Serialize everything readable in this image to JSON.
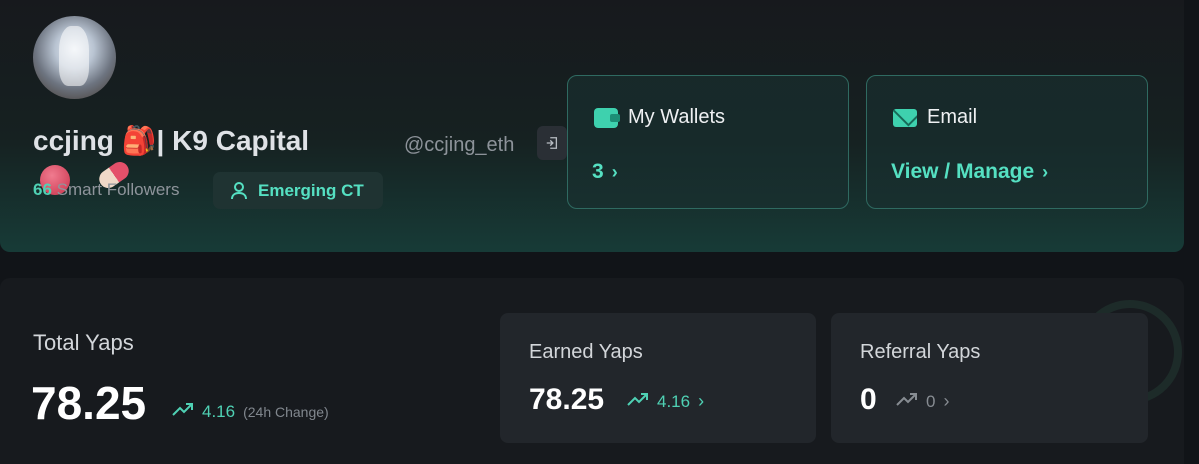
{
  "profile": {
    "display_name": "ccjing 🎒| K9 Capital",
    "display_name_line2": "( 🔴 . 💊 )",
    "handle": "@ccjing_eth",
    "smart_followers_count": "66",
    "smart_followers_label": "Smart Followers",
    "badge": "Emerging CT"
  },
  "wallets": {
    "title": "My Wallets",
    "value": "3"
  },
  "email": {
    "title": "Email",
    "value": "View / Manage"
  },
  "totals": {
    "label": "Total Yaps",
    "value": "78.25",
    "change": "4.16",
    "change_note": "(24h Change)"
  },
  "earned": {
    "label": "Earned Yaps",
    "value": "78.25",
    "change": "4.16"
  },
  "referral": {
    "label": "Referral Yaps",
    "value": "0",
    "change": "0"
  },
  "colors": {
    "accent": "#4fd1b4",
    "background": "#111418",
    "card": "#22262b"
  }
}
